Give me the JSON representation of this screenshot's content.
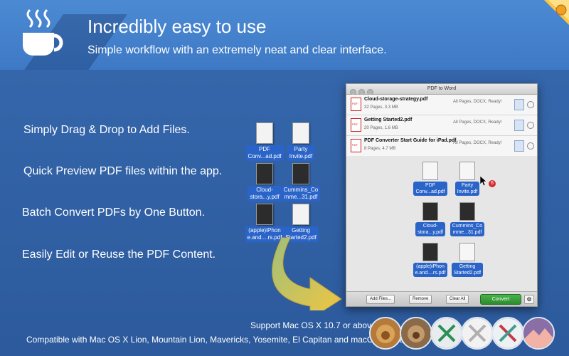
{
  "header": {
    "title": "Incredibly easy to use",
    "subtitle": "Simple workflow with an extremely neat and clear interface."
  },
  "features": [
    "Simply Drag & Drop to Add Files.",
    "Quick Preview PDF files within the app.",
    "Batch Convert PDFs by One Button.",
    "Easily Edit or Reuse the PDF Content."
  ],
  "desktop_files": [
    {
      "line1": "PDF",
      "line2": "Conv...ad.pdf"
    },
    {
      "line1": "Party",
      "line2": "Invite.pdf"
    },
    {
      "line1": "Cloud-",
      "line2": "stora...y.pdf"
    },
    {
      "line1": "Cummins_Co",
      "line2": "mme...31.pdf"
    },
    {
      "line1": "(apple)iPhon",
      "line2": "e.and....rs.pdf"
    },
    {
      "line1": "Getting",
      "line2": "Started2.pdf"
    }
  ],
  "window": {
    "title": "PDF to Word",
    "files": [
      {
        "name": "Cloud-storage-strategy.pdf",
        "meta": "32 Pages, 3.3 MB",
        "status": "All Pages, DOCX, Ready!"
      },
      {
        "name": "Getting Started2.pdf",
        "meta": "20 Pages, 1.6 MB",
        "status": "All Pages, DOCX, Ready!"
      },
      {
        "name": "PDF Converter Start Guide for iPad.pdf",
        "meta": "8 Pages, 4.7 MB",
        "status": "All Pages, DOCX, Ready!"
      }
    ],
    "drag_count": "6",
    "buttons": {
      "add": "Add Files...",
      "remove": "Remove",
      "clear": "Clear All",
      "convert": "Convert"
    }
  },
  "support": {
    "line1": "Support Mac OS X 10.7 or above.",
    "line2": "Compatible with Mac OS X Lion, Mountain Lion, Mavericks, Yosemite, El Capitan and macOS Sierra."
  },
  "colors": {
    "banner": "#4a86d0",
    "background": "#2f5fa4",
    "accent_blue": "#2a64c8",
    "convert_green": "#3aa13d"
  },
  "os_icons": [
    "lion-icon",
    "mountain-lion-icon",
    "mavericks-icon",
    "yosemite-icon",
    "el-capitan-icon",
    "sierra-icon"
  ]
}
